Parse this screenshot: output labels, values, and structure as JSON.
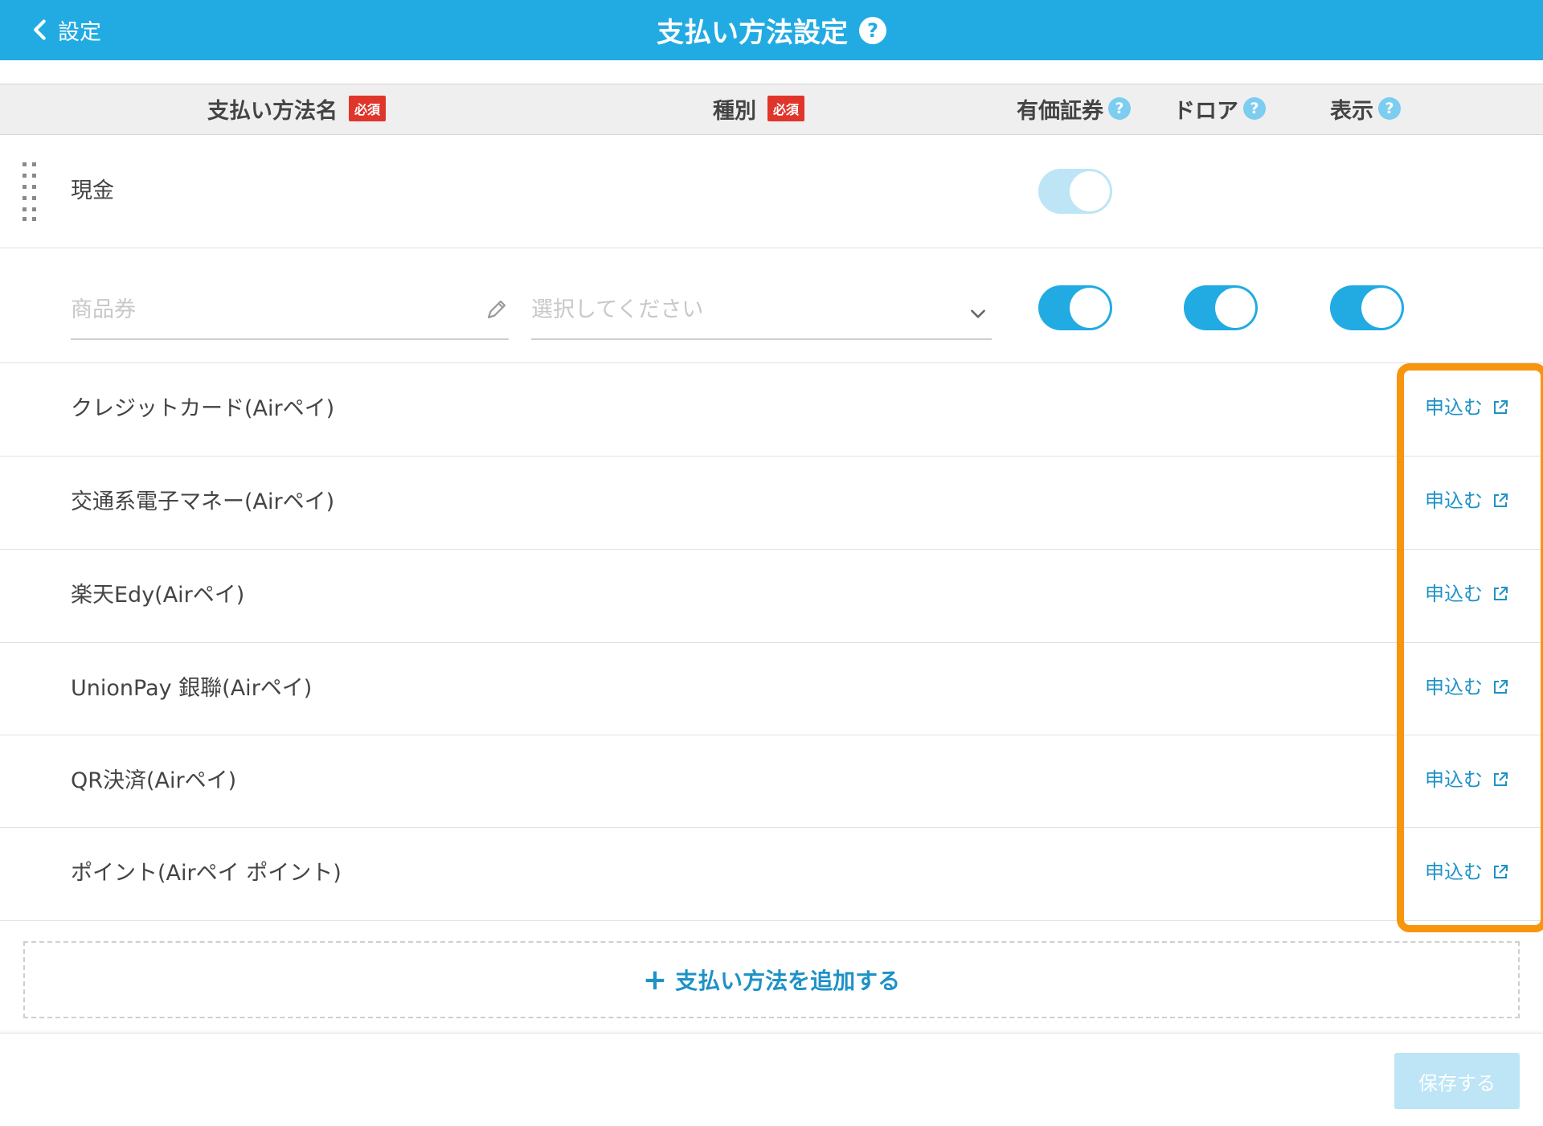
{
  "header": {
    "back_label": "設定",
    "title": "支払い方法設定",
    "help": "?"
  },
  "columns": {
    "name": "支払い方法名",
    "type": "種別",
    "required_badge": "必須",
    "securities": "有価証券",
    "drawer": "ドロア",
    "display": "表示",
    "help": "?"
  },
  "cash_row": {
    "label": "現金"
  },
  "new_row": {
    "name_placeholder": "商品券",
    "type_placeholder": "選択してください"
  },
  "airpay_rows": [
    {
      "label": "クレジットカード(Airペイ)",
      "action": "申込む"
    },
    {
      "label": "交通系電子マネー(Airペイ)",
      "action": "申込む"
    },
    {
      "label": "楽天Edy(Airペイ)",
      "action": "申込む"
    },
    {
      "label": "UnionPay 銀聯(Airペイ)",
      "action": "申込む"
    },
    {
      "label": "QR決済(Airペイ)",
      "action": "申込む"
    },
    {
      "label": "ポイント(Airペイ ポイント)",
      "action": "申込む"
    }
  ],
  "add_button": {
    "plus": "+",
    "label": "支払い方法を追加する"
  },
  "save_button": {
    "label": "保存する"
  },
  "colors": {
    "brand": "#22ABE3",
    "link": "#1E92C6",
    "required": "#E0352B",
    "highlight": "#F7950D",
    "toggle_off_state": "#BDE5F6"
  },
  "toggles": {
    "cash_securities": "on-disabled",
    "new_securities": "on",
    "new_drawer": "on",
    "new_display": "on"
  }
}
